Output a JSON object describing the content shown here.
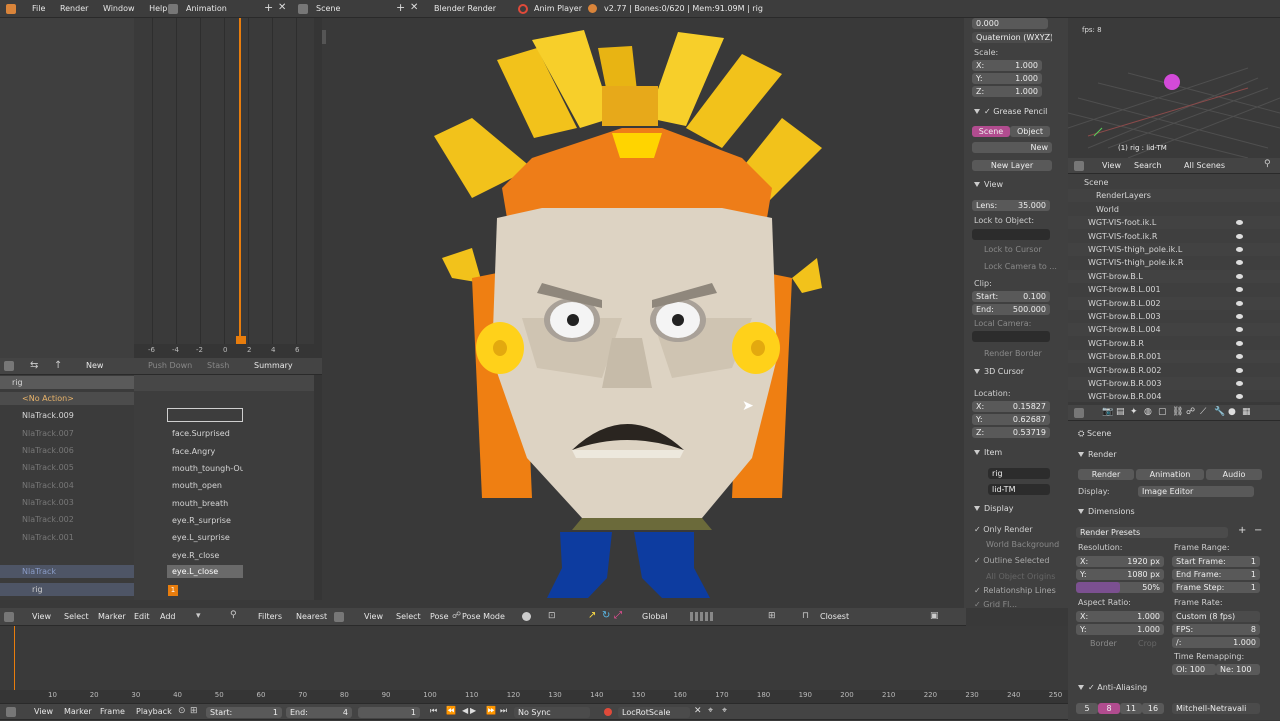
{
  "topbar": {
    "menus": [
      "File",
      "Render",
      "Window",
      "Help"
    ],
    "screen": "Animation",
    "scene": "Scene",
    "engine": "Blender Render",
    "anim_player": "Anim Player",
    "stats": "v2.77 | Bones:0/620 | Mem:91.09M | rig"
  },
  "graph": {
    "ticks": [
      "-6",
      "-4",
      "-2",
      "0",
      "2",
      "4",
      "6"
    ]
  },
  "nla": {
    "header": {
      "new": "New",
      "push_down": "Push Down",
      "stash": "Stash",
      "summary": "Summary"
    },
    "tracks": [
      {
        "name": "rig"
      },
      {
        "name": "<No Action>"
      },
      {
        "name": "NlaTrack.009"
      },
      {
        "name": "NlaTrack.007"
      },
      {
        "name": "NlaTrack.006"
      },
      {
        "name": "NlaTrack.005"
      },
      {
        "name": "NlaTrack.004"
      },
      {
        "name": "NlaTrack.003"
      },
      {
        "name": "NlaTrack.002"
      },
      {
        "name": "NlaTrack.001"
      },
      {
        "name": "NlaTrack"
      },
      {
        "name": "rig"
      }
    ],
    "strips": [
      "face.Surprised",
      "face.Angry",
      "mouth_toungh-Out",
      "mouth_open",
      "mouth_breath",
      "eye.R_surprise",
      "eye.L_surprise",
      "eye.R_close",
      "eye.L_close"
    ],
    "frame_marker": "1",
    "bottom_header": {
      "view": "View",
      "select": "Select",
      "marker": "Marker",
      "edit": "Edit",
      "add": "Add",
      "filters": "Filters",
      "nearest": "Nearest"
    }
  },
  "viewport": {
    "header": {
      "view": "View",
      "select": "Select",
      "pose": "Pose",
      "mode": "Pose Mode",
      "orientation": "Global",
      "pivot": "Closest"
    }
  },
  "npanel": {
    "rot_z": "0.000",
    "rotation_mode": "Quaternion (WXYZ)",
    "scale_label": "Scale:",
    "scale": [
      {
        "axis": "X:",
        "value": "1.000"
      },
      {
        "axis": "Y:",
        "value": "1.000"
      },
      {
        "axis": "Z:",
        "value": "1.000"
      }
    ],
    "grease_pencil": "Grease Pencil",
    "gp_scene": "Scene",
    "gp_object": "Object",
    "gp_new": "New",
    "gp_new_layer": "New Layer",
    "view_label": "View",
    "lens_label": "Lens:",
    "lens": "35.000",
    "lock_to_object": "Lock to Object:",
    "lock_to_cursor": "Lock to Cursor",
    "lock_camera": "Lock Camera to ...",
    "clip_label": "Clip:",
    "clip_start_label": "Start:",
    "clip_start": "0.100",
    "clip_end_label": "End:",
    "clip_end": "500.000",
    "local_camera": "Local Camera:",
    "render_border": "Render Border",
    "cursor_label": "3D Cursor",
    "location_label": "Location:",
    "cursor": [
      {
        "axis": "X:",
        "value": "0.15827"
      },
      {
        "axis": "Y:",
        "value": "0.62687"
      },
      {
        "axis": "Z:",
        "value": "0.53719"
      }
    ],
    "item_label": "Item",
    "item_name": "rig",
    "item_bone": "lid-TM",
    "display_label": "Display",
    "only_render": "Only Render",
    "world_background": "World Background",
    "outline_selected": "Outline Selected",
    "all_object_origins": "All Object Origins",
    "relationship_lines": "Relationship Lines",
    "grid_floor": "Grid Fl..."
  },
  "camera_view": {
    "fps": "fps: 8",
    "label": "(1) rig : lid-TM"
  },
  "outliner": {
    "header": {
      "view": "View",
      "search": "Search",
      "filter": "All Scenes"
    },
    "items": [
      "Scene",
      "RenderLayers",
      "World",
      "WGT-VIS-foot.ik.L",
      "WGT-VIS-foot.ik.R",
      "WGT-VIS-thigh_pole.ik.L",
      "WGT-VIS-thigh_pole.ik.R",
      "WGT-brow.B.L",
      "WGT-brow.B.L.001",
      "WGT-brow.B.L.002",
      "WGT-brow.B.L.003",
      "WGT-brow.B.L.004",
      "WGT-brow.B.R",
      "WGT-brow.B.R.001",
      "WGT-brow.B.R.002",
      "WGT-brow.B.R.003",
      "WGT-brow.B.R.004"
    ]
  },
  "properties": {
    "breadcrumb": "Scene",
    "render_panel": "Render",
    "render_btn": "Render",
    "animation_btn": "Animation",
    "audio_btn": "Audio",
    "display_label": "Display:",
    "display_value": "Image Editor",
    "dimensions": "Dimensions",
    "render_presets": "Render Presets",
    "resolution_label": "Resolution:",
    "res_x_label": "X:",
    "res_x": "1920 px",
    "res_y_label": "Y:",
    "res_y": "1080 px",
    "res_pct": "50%",
    "res_pct_value": 0.5,
    "aspect_label": "Aspect Ratio:",
    "aspect_x": "1.000",
    "aspect_y": "1.000",
    "border": "Border",
    "crop": "Crop",
    "frame_range_label": "Frame Range:",
    "start_frame_label": "Start Frame:",
    "start_frame": "1",
    "end_frame_label": "End Frame:",
    "end_frame": "1",
    "frame_step_label": "Frame Step:",
    "frame_step": "1",
    "frame_rate_label": "Frame Rate:",
    "frame_rate": "Custom (8 fps)",
    "fps_label": "FPS:",
    "fps": "8",
    "fps_base_label": "/:",
    "fps_base": "1.000",
    "time_remap_label": "Time Remapping:",
    "remap_old": "Ol: 100",
    "remap_new": "Ne: 100",
    "anti_aliasing": "Anti-Aliasing",
    "aa_samples": [
      "5",
      "8",
      "11",
      "16"
    ],
    "aa_filter": "Mitchell-Netravali"
  },
  "timeline": {
    "ticks": [
      "10",
      "20",
      "30",
      "40",
      "50",
      "60",
      "70",
      "80",
      "90",
      "100",
      "110",
      "120",
      "130",
      "140",
      "150",
      "160",
      "170",
      "180",
      "190",
      "200",
      "210",
      "220",
      "230",
      "240",
      "250"
    ],
    "header": {
      "view": "View",
      "marker": "Marker",
      "frame": "Frame",
      "playback": "Playback",
      "start_label": "Start:",
      "start": "1",
      "end_label": "End:",
      "end": "4",
      "current": "1",
      "sync": "No Sync",
      "keying": "LocRotScale"
    }
  },
  "colors": {
    "accent_orange": "#e87d0d",
    "select_blue": "#5680c2",
    "header": "#444444"
  }
}
